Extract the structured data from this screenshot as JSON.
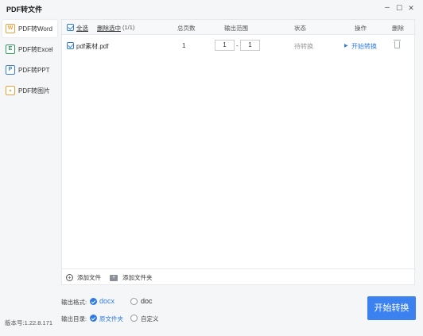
{
  "window": {
    "title": "PDF转文件",
    "minimize_glyph": "–",
    "maximize_glyph": "☐",
    "close_glyph": "✕"
  },
  "sidebar": {
    "items": [
      {
        "label": "PDF转Word",
        "icon": "word-icon",
        "icon_glyph": "W",
        "color": "#e8a33d",
        "active": true
      },
      {
        "label": "PDF转Excel",
        "icon": "excel-icon",
        "icon_glyph": "E",
        "color": "#2e9e5b",
        "active": false
      },
      {
        "label": "PDF转PPT",
        "icon": "ppt-icon",
        "icon_glyph": "P",
        "color": "#3b7dd8",
        "active": false
      },
      {
        "label": "PDF转图片",
        "icon": "image-icon",
        "icon_glyph": "▲",
        "color": "#e8a33d",
        "active": false
      }
    ],
    "version": "版本号:1.22.8.171"
  },
  "table": {
    "select_all": "全选",
    "delete_selected": "删除选中",
    "count": "(1/1)",
    "headers": {
      "pages": "总页数",
      "range": "输出范围",
      "status": "状态",
      "action": "操作",
      "delete": "删除"
    },
    "rows": [
      {
        "file": "pdf素材.pdf",
        "pages": "1",
        "range_from": "1",
        "range_sep": "-",
        "range_to": "1",
        "status": "待转换",
        "action_glyph": "▶",
        "action": "开始转换"
      }
    ]
  },
  "footer": {
    "add_file": "添加文件",
    "add_folder": "添加文件夹"
  },
  "options": {
    "format_label": "输出格式:",
    "format_docx": "docx",
    "format_doc": "doc",
    "dir_label": "输出目录:",
    "dir_source": "原文件夹",
    "dir_custom": "自定义"
  },
  "start_button": "开始转换",
  "colors": {
    "accent": "#3b82f0",
    "link": "#2f7be6"
  }
}
